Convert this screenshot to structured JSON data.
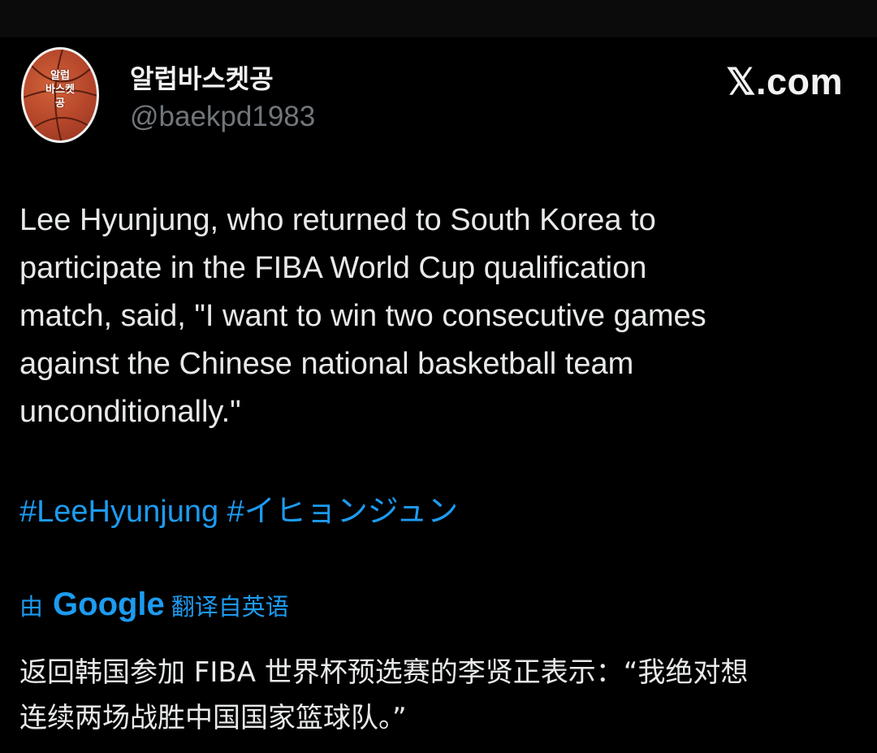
{
  "author": {
    "display_name": "알럽바스켓공",
    "handle": "@baekpd1983",
    "avatar_text": "알럽\n바스켓\n공"
  },
  "brand": "𝕏.com",
  "tweet": {
    "lines": [
      "Lee Hyunjung, who returned to South Korea to",
      "participate in the FIBA World Cup qualification",
      "match, said, \"I want to win two consecutive games",
      "against the Chinese national basketball team",
      "unconditionally.\""
    ],
    "hashtags": [
      "#LeeHyunjung",
      "#イヒョンジュン"
    ]
  },
  "translation": {
    "by_label": "由",
    "provider": "Google",
    "suffix": "翻译自英语",
    "lines": [
      "返回韩国参加 FIBA 世界杯预选赛的李贤正表示：“我绝对想",
      "连续两场战胜中国国家篮球队。”"
    ]
  },
  "colors": {
    "background": "#000000",
    "text": "#e7e9ea",
    "secondary_text": "#71767b",
    "link": "#1d9bf0"
  }
}
